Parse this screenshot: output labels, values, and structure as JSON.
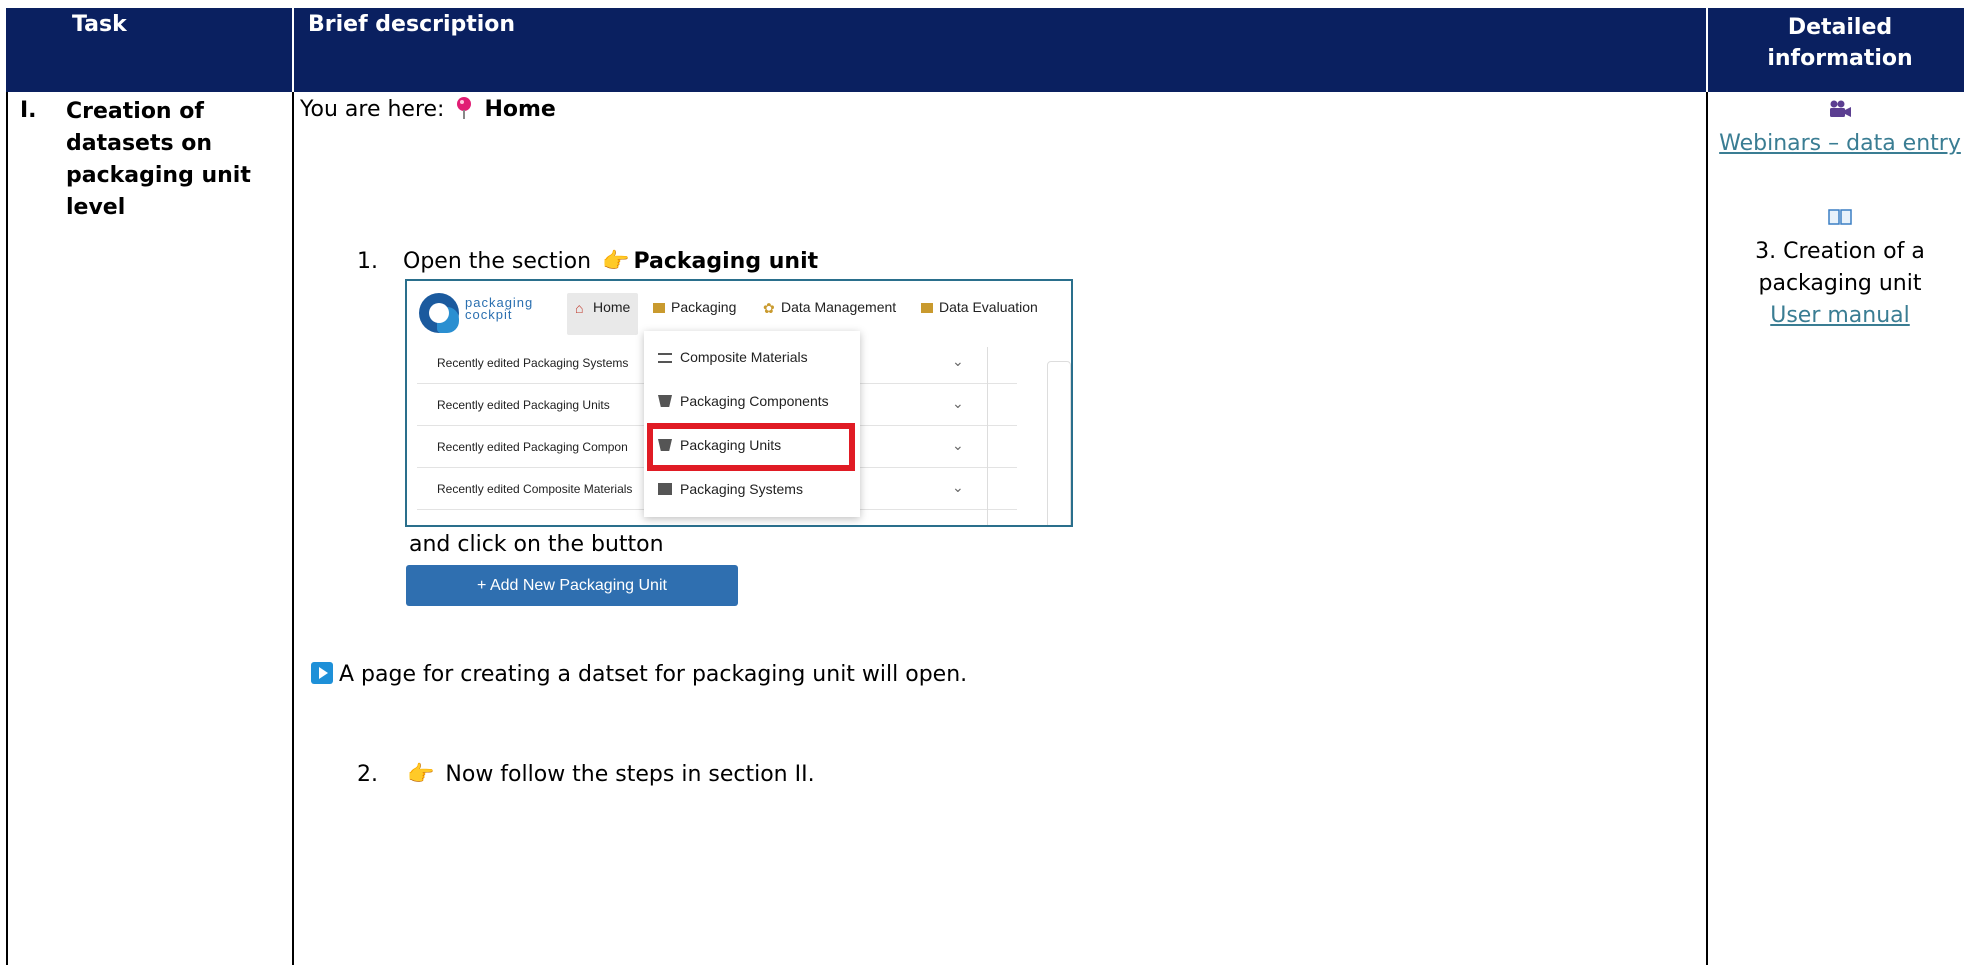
{
  "header": {
    "task": "Task",
    "brief": "Brief description",
    "detail": "Detailed information"
  },
  "row": {
    "number": "I.",
    "task_title": "Creation of datasets on packaging unit level",
    "you_are_here_prefix": "You are here:",
    "you_are_here_location": "Home",
    "step1_number": "1.",
    "step1_text_prefix": "Open the section",
    "step1_text_bold": "Packaging unit",
    "and_click": "and click on the button",
    "add_button": "+   Add New Packaging Unit",
    "note": "A page for creating a datset for packaging unit will open.",
    "step2_number": "2.",
    "step2_text": "Now follow the steps in section II."
  },
  "screenshot": {
    "logo_text_line1": "packaging",
    "logo_text_line2": "cockpit",
    "nav_home": "Home",
    "nav_packaging": "Packaging",
    "nav_data_management": "Data Management",
    "nav_data_evaluation": "Data Evaluation",
    "recent_items": [
      "Recently edited Packaging Systems",
      "Recently edited Packaging Units",
      "Recently edited Packaging Compon",
      "Recently edited Composite Materials"
    ],
    "dropdown_items": [
      "Composite Materials",
      "Packaging Components",
      "Packaging Units",
      "Packaging Systems"
    ],
    "chevron": "⌄"
  },
  "detail": {
    "webinar_link": "Webinars – data entry",
    "manual_text": "3. Creation of a packaging unit",
    "manual_link": "User manual"
  },
  "colors": {
    "header_bg": "#0a2060",
    "link": "#3a7d93",
    "highlight": "#e01b24",
    "button": "#2f6fb0"
  }
}
